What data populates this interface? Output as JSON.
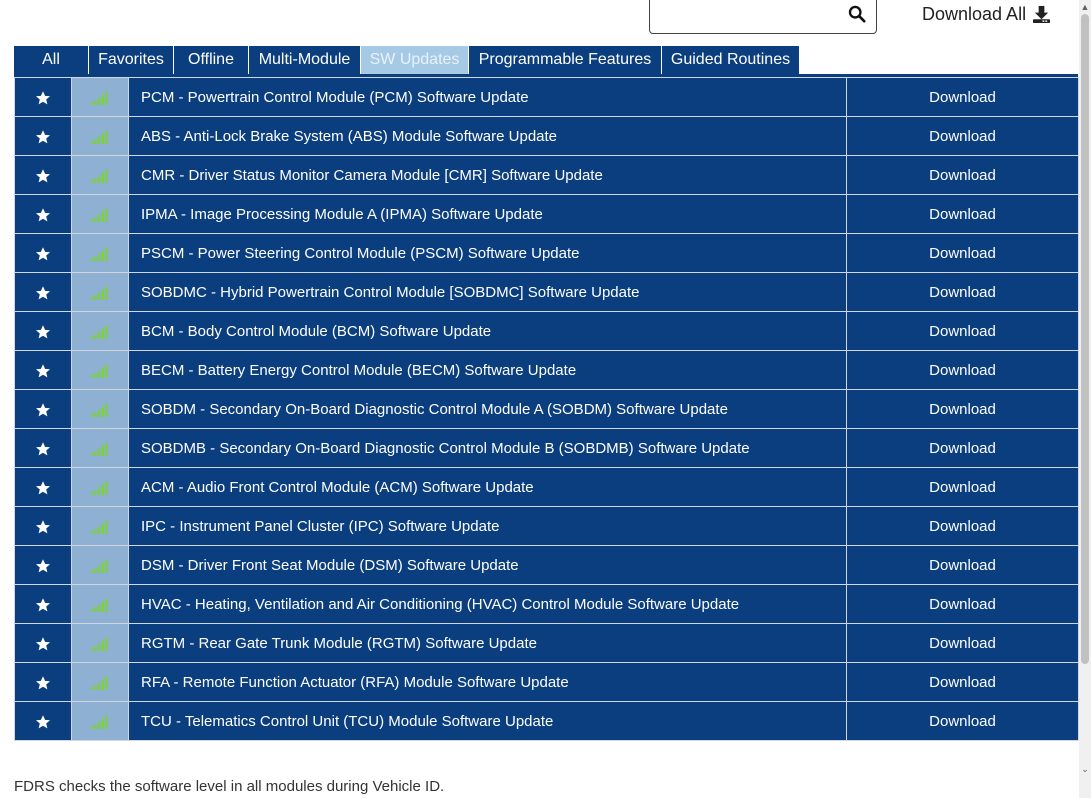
{
  "search": {
    "value": "",
    "placeholder": "",
    "icon": "search-icon"
  },
  "header": {
    "download_all_label": "Download All",
    "download_all_icon": "download-icon"
  },
  "tabs": [
    {
      "label": "All",
      "active": false
    },
    {
      "label": "Favorites",
      "active": false
    },
    {
      "label": "Offline",
      "active": false
    },
    {
      "label": "Multi-Module",
      "active": false
    },
    {
      "label": "SW Updates",
      "active": true
    },
    {
      "label": "Programmable Features",
      "active": false
    },
    {
      "label": "Guided Routines",
      "active": false
    }
  ],
  "colors": {
    "row_bg": "#0b3e7f",
    "signal_cell_bg": "#8eb0d2",
    "signal_bars": "#7fd13b",
    "active_tab_bg": "#a6c9e6"
  },
  "rows": [
    {
      "name": "PCM - Powertrain Control Module (PCM) Software Update",
      "action": "Download"
    },
    {
      "name": "ABS - Anti-Lock Brake System (ABS) Module Software Update",
      "action": "Download"
    },
    {
      "name": "CMR - Driver Status Monitor Camera Module [CMR] Software Update",
      "action": "Download"
    },
    {
      "name": "IPMA - Image Processing Module A (IPMA) Software Update",
      "action": "Download"
    },
    {
      "name": "PSCM - Power Steering Control Module (PSCM) Software Update",
      "action": "Download"
    },
    {
      "name": "SOBDMC - Hybrid Powertrain Control Module [SOBDMC] Software Update",
      "action": "Download"
    },
    {
      "name": "BCM - Body Control Module (BCM) Software Update",
      "action": "Download"
    },
    {
      "name": "BECM - Battery Energy Control Module (BECM) Software Update",
      "action": "Download"
    },
    {
      "name": "SOBDM - Secondary On-Board Diagnostic Control Module A (SOBDM) Software Update",
      "action": "Download"
    },
    {
      "name": "SOBDMB - Secondary On-Board Diagnostic Control Module B (SOBDMB) Software Update",
      "action": "Download"
    },
    {
      "name": "ACM - Audio Front Control Module (ACM) Software Update",
      "action": "Download"
    },
    {
      "name": "IPC - Instrument Panel Cluster (IPC) Software Update",
      "action": "Download"
    },
    {
      "name": "DSM - Driver Front Seat Module (DSM) Software Update",
      "action": "Download"
    },
    {
      "name": "HVAC - Heating, Ventilation and Air Conditioning (HVAC) Control Module Software Update",
      "action": "Download"
    },
    {
      "name": "RGTM - Rear Gate Trunk Module (RGTM) Software Update",
      "action": "Download"
    },
    {
      "name": "RFA - Remote Function Actuator (RFA) Module Software Update",
      "action": "Download"
    },
    {
      "name": "TCU - Telematics Control Unit (TCU) Module Software Update",
      "action": "Download"
    }
  ],
  "footer": {
    "note": "FDRS checks the software level in all modules during Vehicle ID."
  }
}
